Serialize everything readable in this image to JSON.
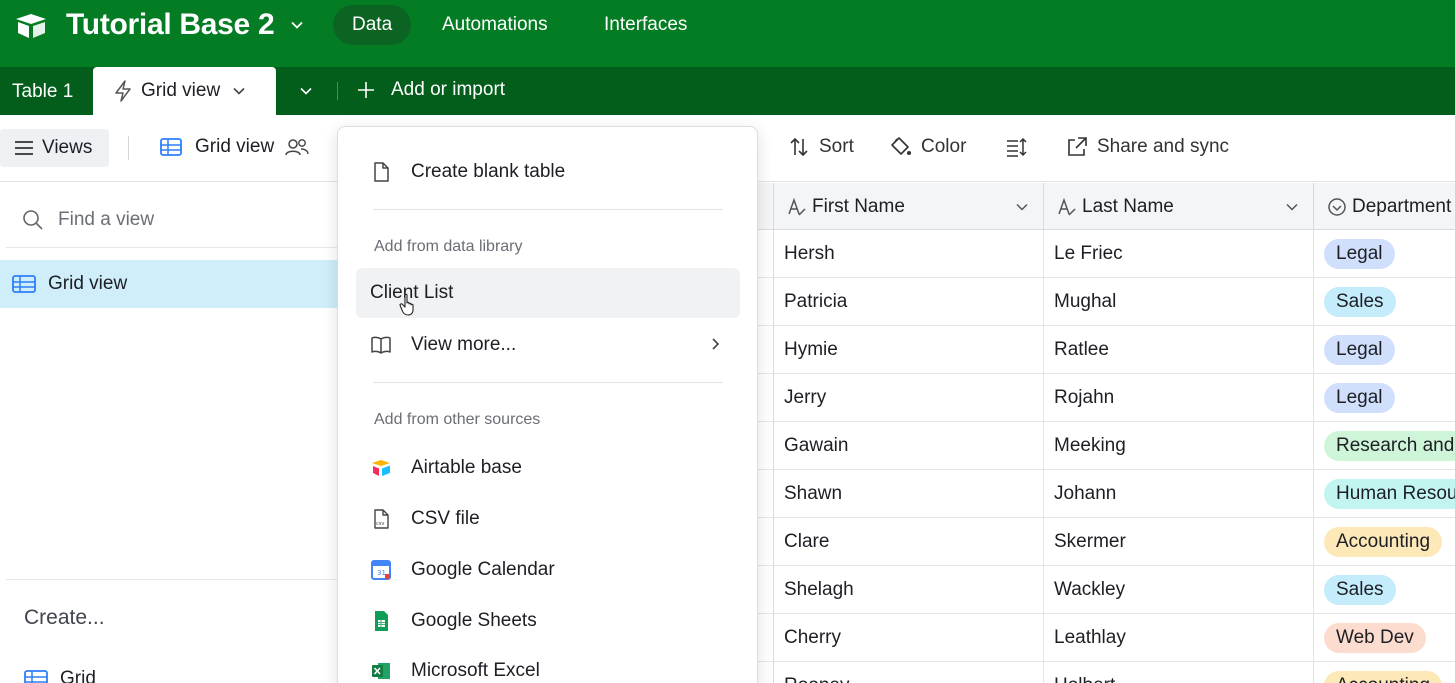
{
  "app": {
    "base_title": "Tutorial Base 2",
    "nav": [
      {
        "label": "Data",
        "active": true
      },
      {
        "label": "Automations",
        "active": false
      },
      {
        "label": "Interfaces",
        "active": false
      }
    ],
    "brand_color": "#047c23"
  },
  "tabbar": {
    "table_tab": "Table 1",
    "view_tab": "Grid view",
    "add_import": "Add or import"
  },
  "toolbar": {
    "views": "Views",
    "grid_view": "Grid view",
    "sort": "Sort",
    "color": "Color",
    "share_sync": "Share and sync"
  },
  "sidebar": {
    "find_placeholder": "Find a view",
    "active_view": "Grid view",
    "create_label": "Create...",
    "create_grid": "Grid"
  },
  "dropdown": {
    "create_blank": "Create blank table",
    "section_library": "Add from data library",
    "client_list": "Client List",
    "view_more": "View more...",
    "section_other": "Add from other sources",
    "sources": [
      {
        "label": "Airtable base",
        "icon": "airtable-logo-icon"
      },
      {
        "label": "CSV file",
        "icon": "csv-file-icon"
      },
      {
        "label": "Google Calendar",
        "icon": "google-calendar-icon"
      },
      {
        "label": "Google Sheets",
        "icon": "google-sheets-icon"
      },
      {
        "label": "Microsoft Excel",
        "icon": "microsoft-excel-icon"
      }
    ]
  },
  "grid": {
    "columns": [
      "First Name",
      "Last Name",
      "Department"
    ],
    "rows": [
      {
        "first": "Hersh",
        "last": "Le Friec",
        "dept": "Legal",
        "dept_color": "#cfdffc"
      },
      {
        "first": "Patricia",
        "last": "Mughal",
        "dept": "Sales",
        "dept_color": "#c4ecfb"
      },
      {
        "first": "Hymie",
        "last": "Ratlee",
        "dept": "Legal",
        "dept_color": "#cfdffc"
      },
      {
        "first": "Jerry",
        "last": "Rojahn",
        "dept": "Legal",
        "dept_color": "#cfdffc"
      },
      {
        "first": "Gawain",
        "last": "Meeking",
        "dept": "Research and",
        "dept_color": "#cff5d9"
      },
      {
        "first": "Shawn",
        "last": "Johann",
        "dept": "Human Resou",
        "dept_color": "#c2f5ef"
      },
      {
        "first": "Clare",
        "last": "Skermer",
        "dept": "Accounting",
        "dept_color": "#fde8b8"
      },
      {
        "first": "Shelagh",
        "last": "Wackley",
        "dept": "Sales",
        "dept_color": "#c4ecfb"
      },
      {
        "first": "Cherry",
        "last": "Leathlay",
        "dept": "Web Dev",
        "dept_color": "#fcdccf"
      },
      {
        "first": "Rooney",
        "last": "Holbert",
        "dept": "Accounting",
        "dept_color": "#fde8b8"
      }
    ]
  }
}
